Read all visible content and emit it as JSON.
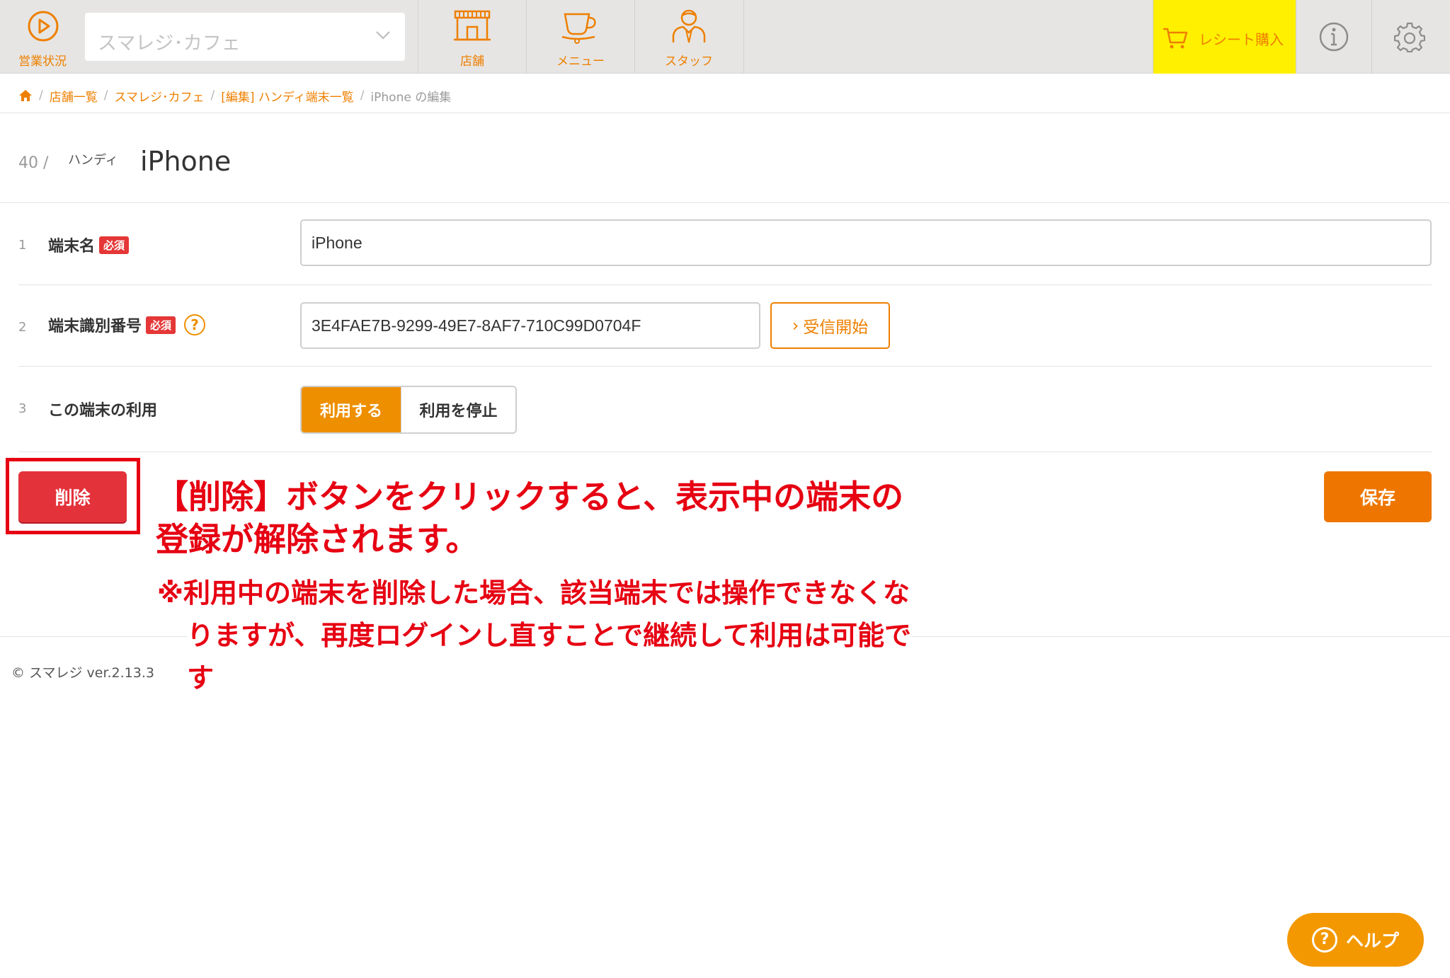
{
  "topbar": {
    "status_label": "営業状況",
    "store_select_value": "スマレジ･カフェ",
    "nav": [
      {
        "label": "店舗"
      },
      {
        "label": "メニュー"
      },
      {
        "label": "スタッフ"
      }
    ],
    "receipt_label": "レシート購入",
    "colors": {
      "accent": "#ee7f00",
      "receipt_bg": "#fff000",
      "bar_bg": "#e6e5e3"
    }
  },
  "breadcrumb": {
    "items": [
      "店舗一覧",
      "スマレジ･カフェ",
      "[編集] ハンディ端末一覧"
    ],
    "current": "iPhone の編集",
    "separator": "/"
  },
  "header": {
    "number": "40 /",
    "type": "ハンディ",
    "title": "iPhone"
  },
  "form": {
    "rows": [
      {
        "num": "1",
        "label": "端末名",
        "required": "必須",
        "value": "iPhone"
      },
      {
        "num": "2",
        "label": "端末識別番号",
        "required": "必須",
        "help": "?",
        "value": "3E4FAE7B-9299-49E7-8AF7-710C99D0704F",
        "button": "受信開始"
      },
      {
        "num": "3",
        "label": "この端末の利用",
        "options": [
          "利用する",
          "利用を停止"
        ],
        "selected": "利用する"
      }
    ]
  },
  "actions": {
    "delete_label": "削除",
    "save_label": "保存",
    "colors": {
      "delete": "#e4323b",
      "save": "#ee7600"
    }
  },
  "annotation": {
    "main": "【削除】ボタンをクリックすると、表示中の端末の登録が解除されます。",
    "note": "※利用中の端末を削除した場合、該当端末では操作できなくなりますが、再度ログインし直すことで継続して利用は可能です",
    "color": "#e60012"
  },
  "footer": {
    "copyright": "© スマレジ ver.2.13.3"
  },
  "help_button": {
    "icon": "?",
    "label": "ヘルプ"
  }
}
